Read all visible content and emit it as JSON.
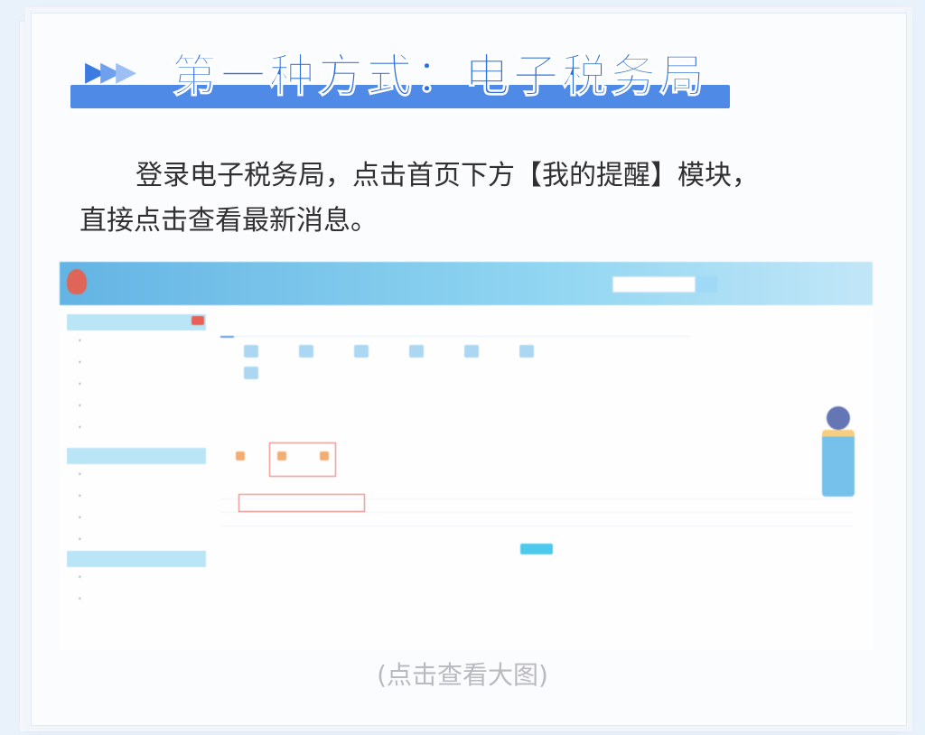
{
  "title": {
    "arrows": "▶▶▶",
    "text": "第一种方式：电子税务局"
  },
  "paragraph": {
    "line1": "登录电子税务局，点击首页下方【我的提醒】模块，",
    "line2": "直接点击查看最新消息。"
  },
  "caption": "(点击查看大图)",
  "colors": {
    "title_blue": "#2e6fdc",
    "band_blue": "#4f8ae6",
    "highlight_red": "#e0584a"
  }
}
